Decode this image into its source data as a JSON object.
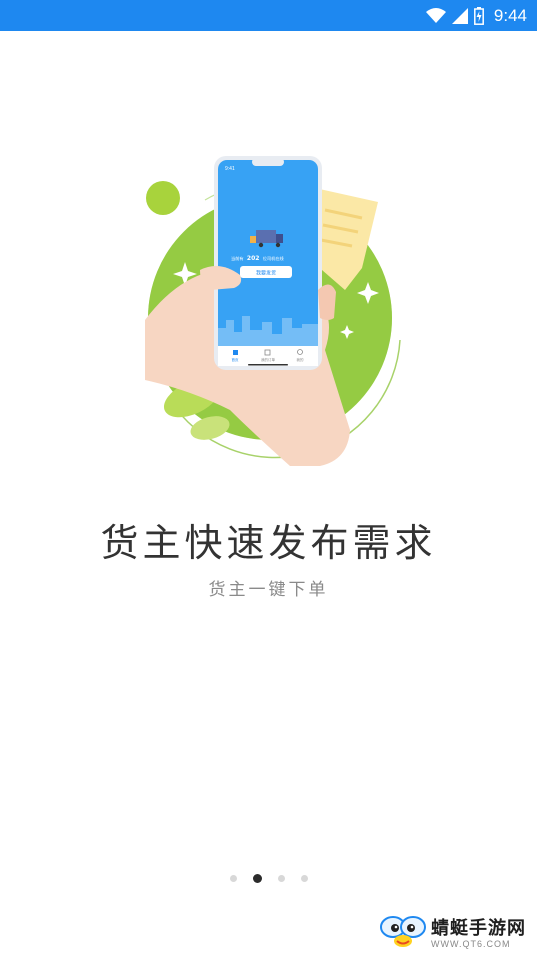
{
  "status_bar": {
    "time": "9:44",
    "icons": [
      "wifi-icon",
      "signal-icon",
      "battery-icon"
    ],
    "color": "#1e88f0"
  },
  "onboarding": {
    "title": "货主快速发布需求",
    "subtitle": "货主一键下单",
    "page_count": 4,
    "active_page": 2
  },
  "phone_mock": {
    "status_time": "9:41",
    "headline_prefix": "当前有",
    "headline_number": "202",
    "headline_suffix": "位司机在线",
    "button_label": "我要发货",
    "tabs": [
      "首页",
      "我的订单",
      "我的"
    ]
  },
  "watermark": {
    "title": "蜻蜓手游网",
    "url": "WWW.QT6.COM"
  },
  "colors": {
    "accent": "#1e88f0",
    "green": "#8cc63f",
    "text_dark": "#333333",
    "text_muted": "#8a8a8a"
  }
}
